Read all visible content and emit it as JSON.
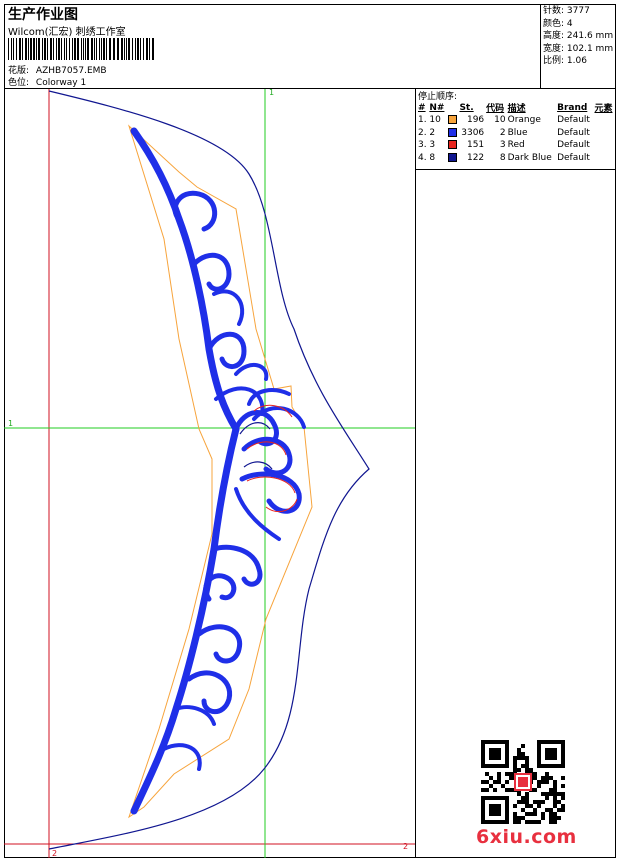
{
  "header": {
    "title": "生产作业图",
    "studio": "Wilcom(汇宏) 刺绣工作室",
    "design_label": "花版:",
    "design_value": "AZHB7057.EMB",
    "colorway_label": "色位:",
    "colorway_value": "Colorway 1"
  },
  "stats": [
    {
      "label": "针数",
      "value": "3777"
    },
    {
      "label": "颜色",
      "value": "4"
    },
    {
      "label": "高度",
      "value": "241.6 mm"
    },
    {
      "label": "宽度",
      "value": "102.1 mm"
    },
    {
      "label": "比例",
      "value": "1.06"
    }
  ],
  "stop_sequence": {
    "title": "停止顺序:",
    "columns": [
      "#",
      "N#",
      "St.",
      "代码",
      "描述",
      "Brand",
      "元素"
    ],
    "rows": [
      {
        "idx": "1.",
        "needle": "10",
        "color": "#F7A43C",
        "stitches": "196",
        "code": "10",
        "desc": "Orange",
        "brand": "Default"
      },
      {
        "idx": "2.",
        "needle": "2",
        "color": "#1F2FE8",
        "stitches": "3306",
        "code": "2",
        "desc": "Blue",
        "brand": "Default"
      },
      {
        "idx": "3.",
        "needle": "3",
        "color": "#E8251E",
        "stitches": "151",
        "code": "3",
        "desc": "Red",
        "brand": "Default"
      },
      {
        "idx": "4.",
        "needle": "8",
        "color": "#101690",
        "stitches": "122",
        "code": "8",
        "desc": "Dark Blue",
        "brand": "Default"
      }
    ]
  },
  "axes": {
    "v1": "1",
    "h1": "1",
    "h2": "2",
    "v2": "2"
  },
  "colors": {
    "stitch_blue": "#1F2FE8",
    "outline_orange": "#F7A43C",
    "accent_red": "#E8251E",
    "outline_navy": "#101690",
    "guide_green": "#22CC22",
    "guide_red": "#D01020"
  },
  "watermark": {
    "text": "6xiu.com"
  }
}
